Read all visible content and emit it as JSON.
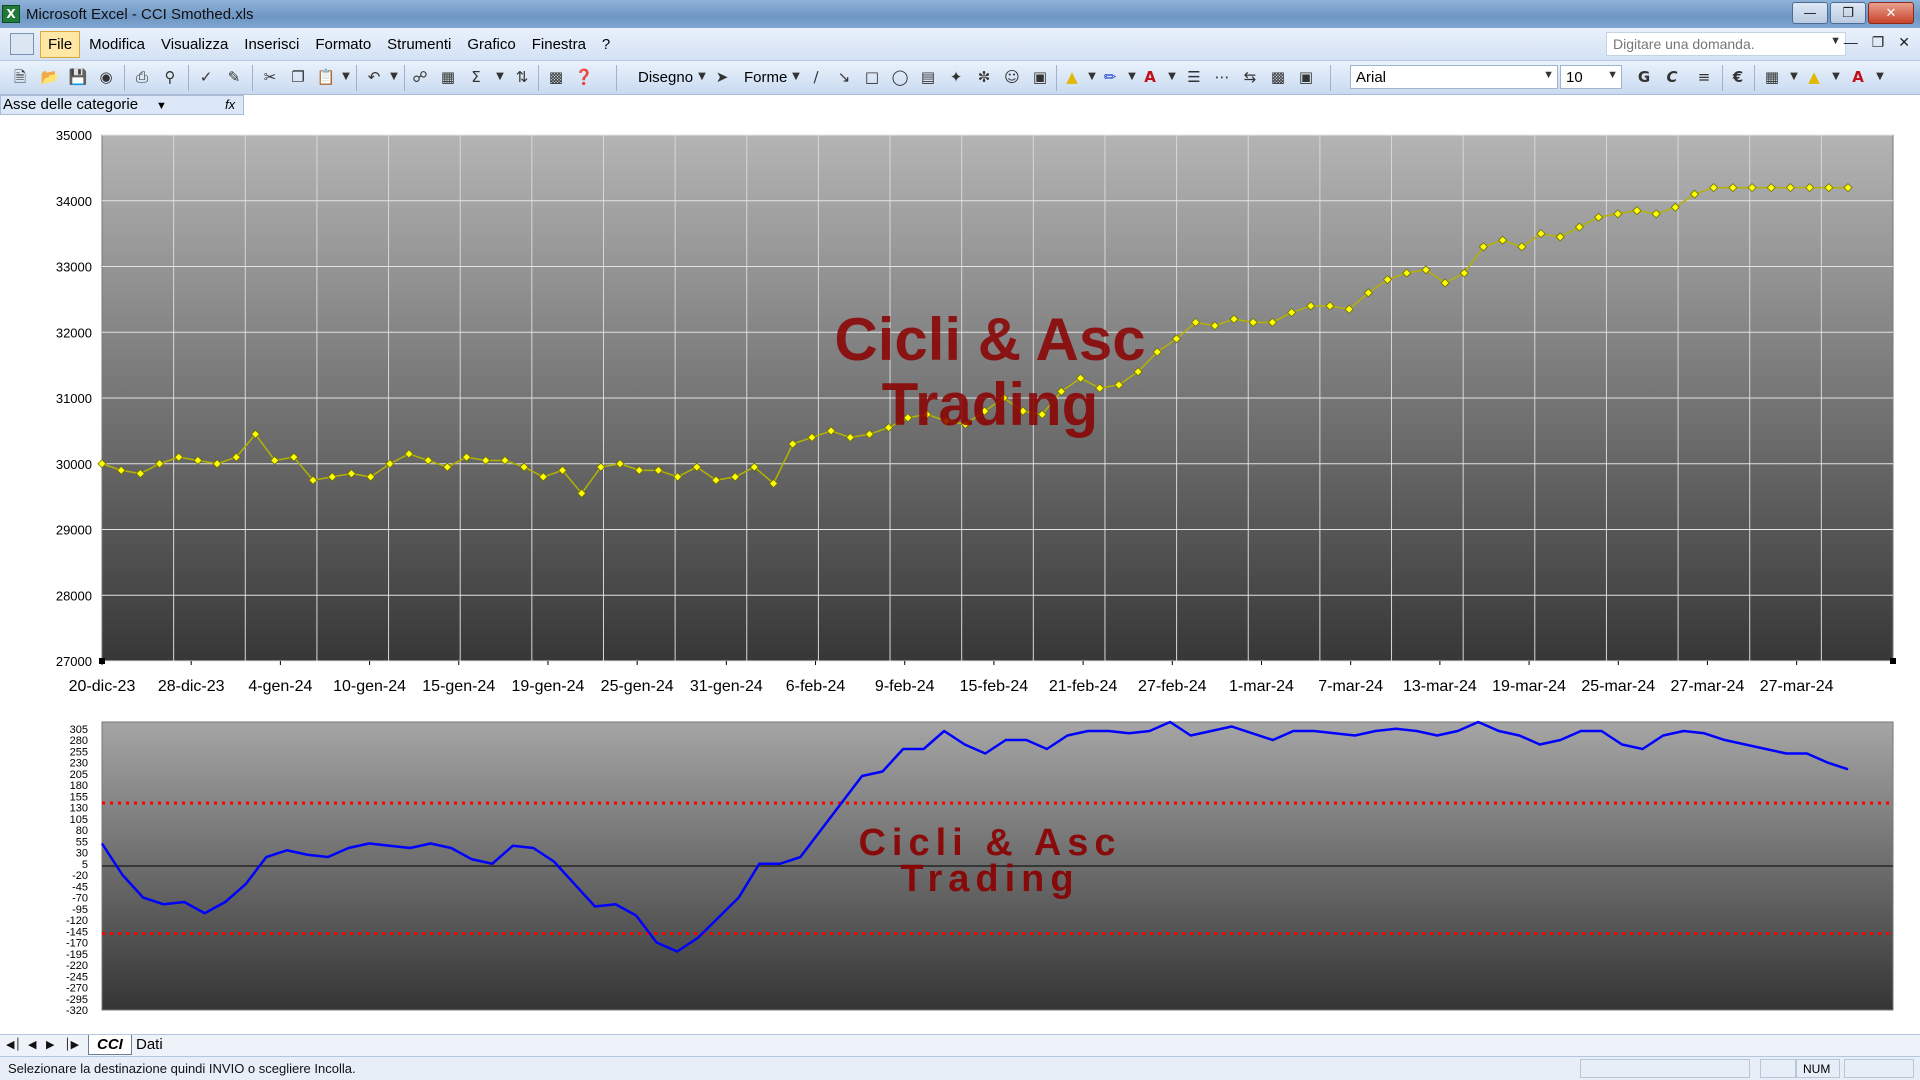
{
  "window": {
    "title": "Microsoft Excel - CCI Smothed.xls",
    "app_icon": "excel-icon"
  },
  "menu": {
    "items": [
      "File",
      "Modifica",
      "Visualizza",
      "Inserisci",
      "Formato",
      "Strumenti",
      "Grafico",
      "Finestra",
      "?"
    ],
    "ask_placeholder": "Digitare una domanda."
  },
  "toolbar": {
    "disegno": "Disegno",
    "forme": "Forme",
    "font": "Arial",
    "size": "10",
    "bold": "G",
    "italic": "C"
  },
  "namebox": {
    "value": "Asse delle categorie",
    "fx": "fx"
  },
  "watermark": {
    "line1": "Cicli & Asc",
    "line2": "Trading"
  },
  "price_chart": {
    "chart_data": {
      "type": "line",
      "yticks": [
        "35000",
        "34000",
        "33000",
        "32000",
        "31000",
        "30000",
        "29000",
        "28000",
        "27000"
      ],
      "ylim": [
        27000,
        35000
      ],
      "xticks": [
        "20-dic-23",
        "28-dic-23",
        "4-gen-24",
        "10-gen-24",
        "15-gen-24",
        "19-gen-24",
        "25-gen-24",
        "31-gen-24",
        "6-feb-24",
        "9-feb-24",
        "15-feb-24",
        "21-feb-24",
        "27-feb-24",
        "1-mar-24",
        "7-mar-24",
        "13-mar-24",
        "19-mar-24",
        "25-mar-24",
        "27-mar-24",
        "27-mar-24"
      ],
      "series": [
        {
          "color": "#ffff00",
          "marker": "diamond",
          "values": [
            30000,
            29900,
            29850,
            30000,
            30100,
            30050,
            30000,
            30100,
            30450,
            30050,
            30100,
            29750,
            29800,
            29850,
            29800,
            30000,
            30150,
            30050,
            29950,
            30100,
            30050,
            30050,
            29950,
            29800,
            29900,
            29550,
            29950,
            30000,
            29900,
            29900,
            29800,
            29950,
            29750,
            29800,
            29950,
            29700,
            30300,
            30400,
            30500,
            30400,
            30450,
            30550,
            30700,
            30750,
            30650,
            30600,
            30800,
            31000,
            30800,
            30750,
            31100,
            31300,
            31150,
            31200,
            31400,
            31700,
            31900,
            32150,
            32100,
            32200,
            32150,
            32150,
            32300,
            32400,
            32400,
            32350,
            32600,
            32800,
            32900,
            32950,
            32750,
            32900,
            33300,
            33400,
            33300,
            33500,
            33450,
            33600,
            33750,
            33800,
            33850,
            33800,
            33900,
            34100,
            34200,
            34200,
            34200,
            34200,
            34200,
            34200,
            34200,
            34200
          ]
        }
      ]
    }
  },
  "cci_chart": {
    "chart_data": {
      "type": "line",
      "yticks": [
        "305",
        "280",
        "255",
        "230",
        "205",
        "180",
        "155",
        "130",
        "105",
        "80",
        "55",
        "30",
        "5",
        "-20",
        "-45",
        "-70",
        "-95",
        "-120",
        "-145",
        "-170",
        "-195",
        "-220",
        "-245",
        "-270",
        "-295",
        "-320"
      ],
      "ylim": [
        -320,
        320
      ],
      "levels": [
        140,
        -150,
        0
      ],
      "series": [
        {
          "color": "#0000ff",
          "values": [
            50,
            -20,
            -70,
            -85,
            -80,
            -105,
            -80,
            -40,
            20,
            35,
            25,
            20,
            40,
            50,
            45,
            40,
            50,
            40,
            15,
            5,
            45,
            40,
            10,
            -40,
            -90,
            -85,
            -110,
            -170,
            -190,
            -160,
            -115,
            -70,
            5,
            5,
            20,
            80,
            140,
            200,
            210,
            260,
            260,
            300,
            270,
            250,
            280,
            280,
            260,
            290,
            300,
            300,
            295,
            300,
            320,
            290,
            300,
            310,
            295,
            280,
            300,
            300,
            295,
            290,
            300,
            305,
            300,
            290,
            300,
            320,
            300,
            290,
            270,
            280,
            300,
            300,
            270,
            260,
            290,
            300,
            295,
            280,
            270,
            260,
            250,
            250,
            230,
            215
          ]
        }
      ]
    }
  },
  "sheets": {
    "tabs": [
      "CCI",
      "Dati"
    ]
  },
  "status": {
    "message": "Selezionare la destinazione quindi INVIO o scegliere Incolla.",
    "num": "NUM"
  }
}
